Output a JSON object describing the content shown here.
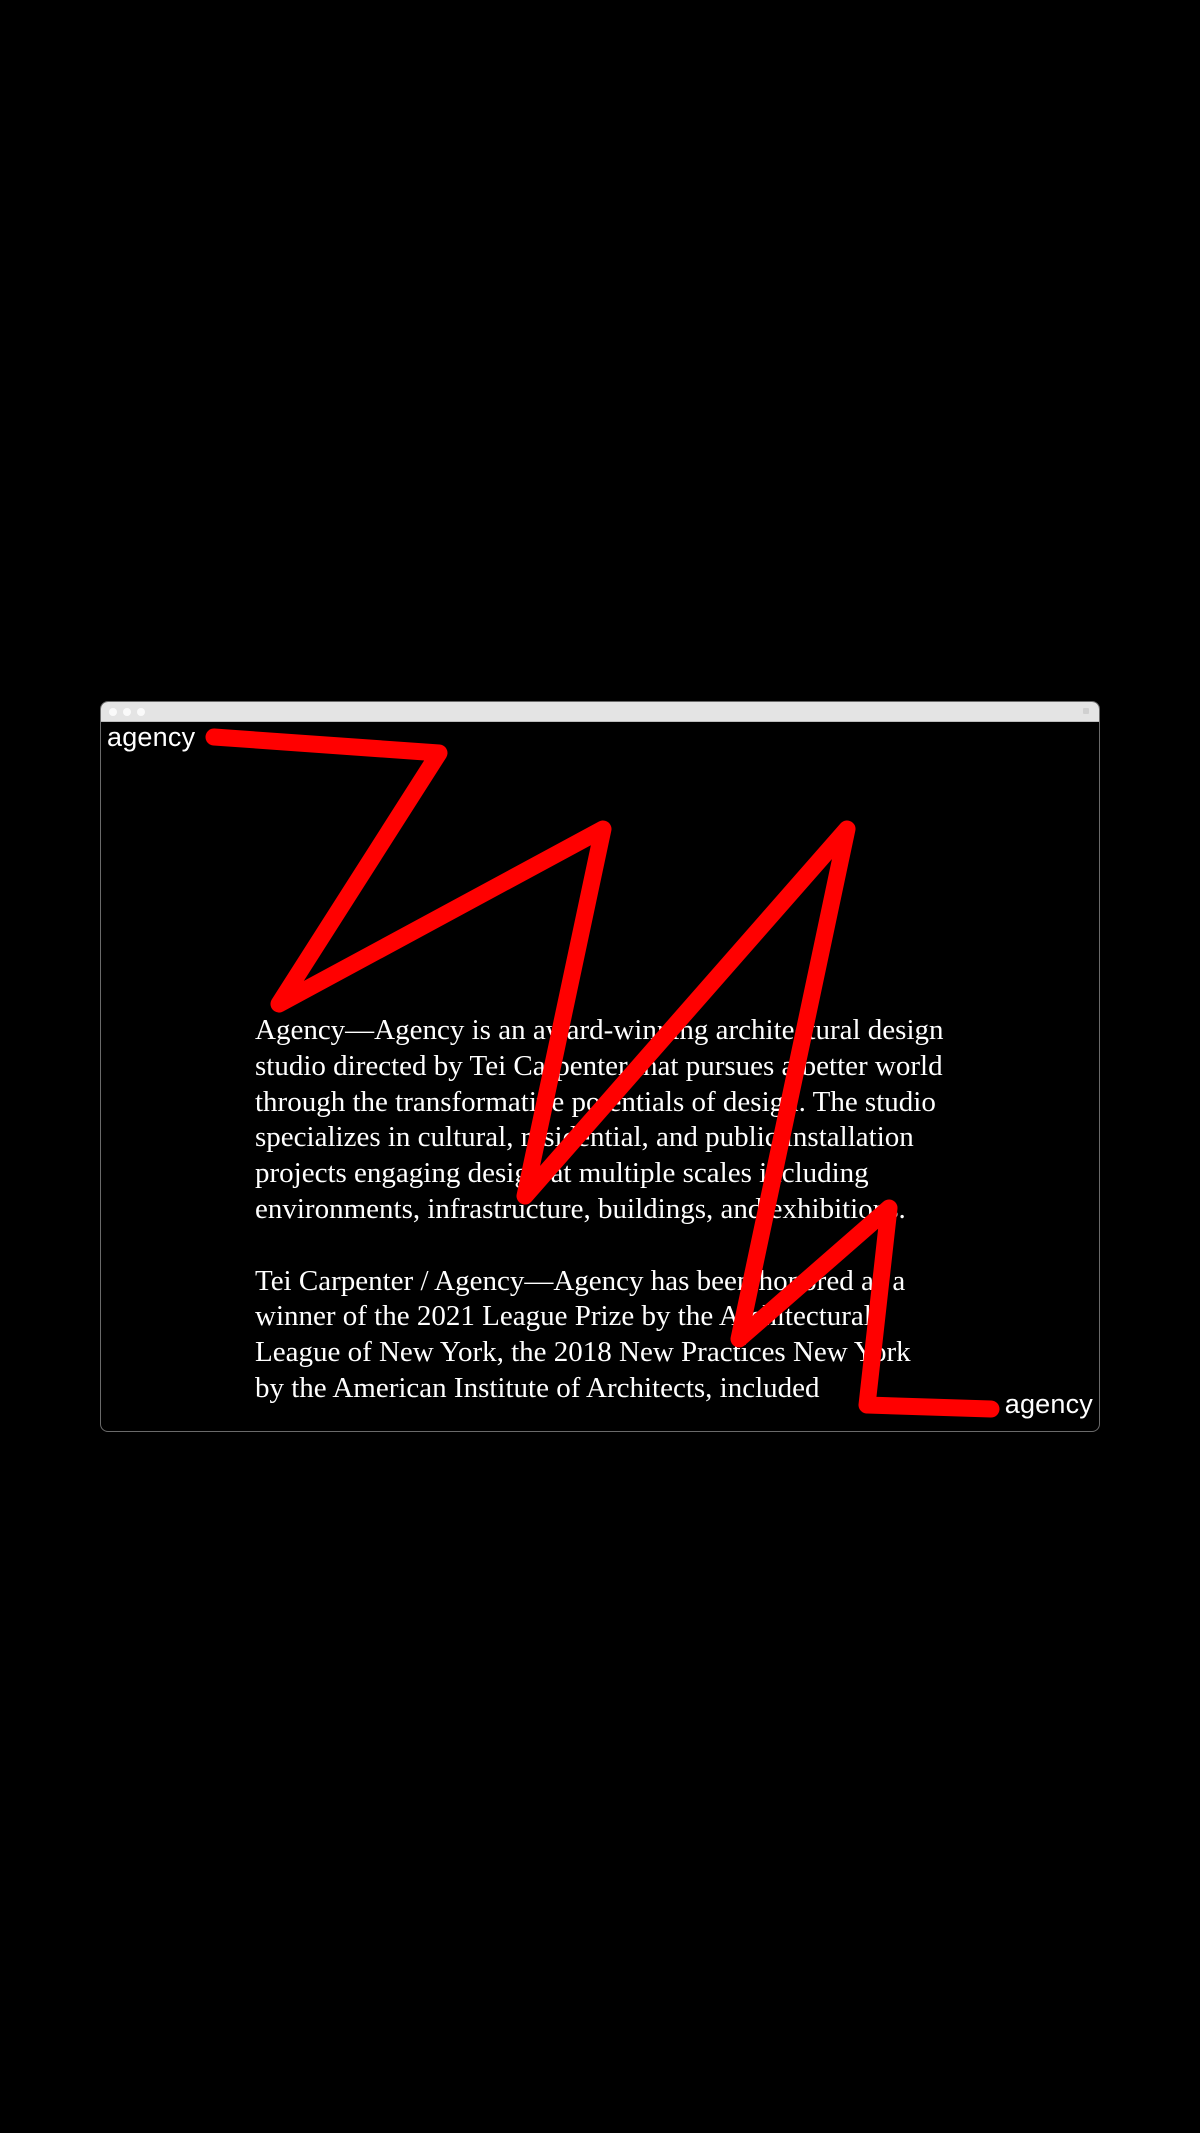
{
  "window": {
    "accent_color": "#ff0000",
    "titlebar_buttons": [
      "close",
      "minimize",
      "zoom"
    ]
  },
  "logo": {
    "top": "agency",
    "bottom": "agency"
  },
  "text": {
    "paragraph_1": "Agency—Agency is an award-winning architectural design studio directed by Tei Carpenter that pursues a better world through the transformative potentials of design. The studio specializes in cultural, residential, and public installation projects engaging design at multiple scales including environments, infrastructure, buildings, and exhibitions.",
    "paragraph_2": "Tei Carpenter / Agency—Agency has been honored as a winner of the 2021 League Prize by the Architectural League of New York, the 2018 New Practices New York by the American Institute of Architects, included"
  }
}
